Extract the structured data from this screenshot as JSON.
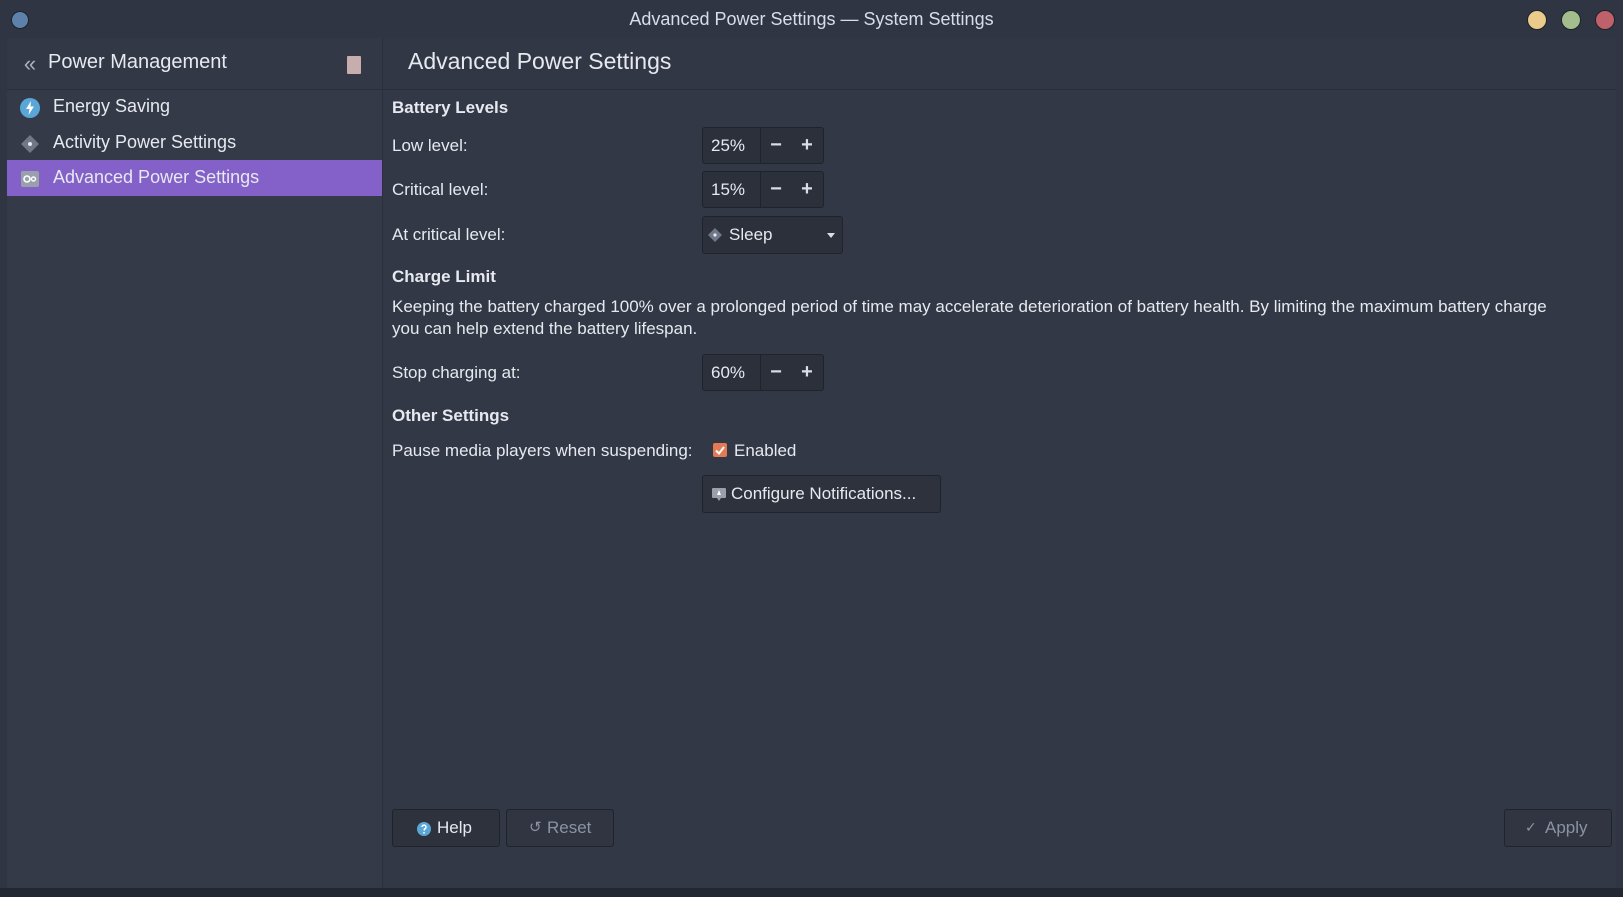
{
  "window": {
    "title": "Advanced Power Settings — System Settings"
  },
  "sidebar": {
    "title": "Power Management",
    "items": [
      {
        "label": "Energy Saving",
        "icon": "energy-saving-icon"
      },
      {
        "label": "Activity Power Settings",
        "icon": "activity-icon"
      },
      {
        "label": "Advanced Power Settings",
        "icon": "advanced-settings-icon",
        "active": true
      }
    ]
  },
  "main": {
    "title": "Advanced Power Settings",
    "battery_levels": {
      "heading": "Battery Levels",
      "low_label": "Low level:",
      "low_value": "25%",
      "critical_label": "Critical level:",
      "critical_value": "15%",
      "at_critical_label": "At critical level:",
      "at_critical_value": "Sleep",
      "minus": "−",
      "plus": "+"
    },
    "charge_limit": {
      "heading": "Charge Limit",
      "description": "Keeping the battery charged 100% over a prolonged period of time may accelerate deterioration of battery health. By limiting the maximum battery charge you can help extend the battery lifespan.",
      "stop_label": "Stop charging at:",
      "stop_value": "60%"
    },
    "other": {
      "heading": "Other Settings",
      "pause_label": "Pause media players when suspending:",
      "pause_checkbox_label": "Enabled",
      "pause_checked": true,
      "configure_label": "Configure Notifications..."
    }
  },
  "footer": {
    "help_label": "Help",
    "reset_label": "Reset",
    "apply_label": "Apply"
  },
  "colors": {
    "accent": "#8461c9",
    "checkbox": "#e27a56",
    "background": "#323845"
  }
}
